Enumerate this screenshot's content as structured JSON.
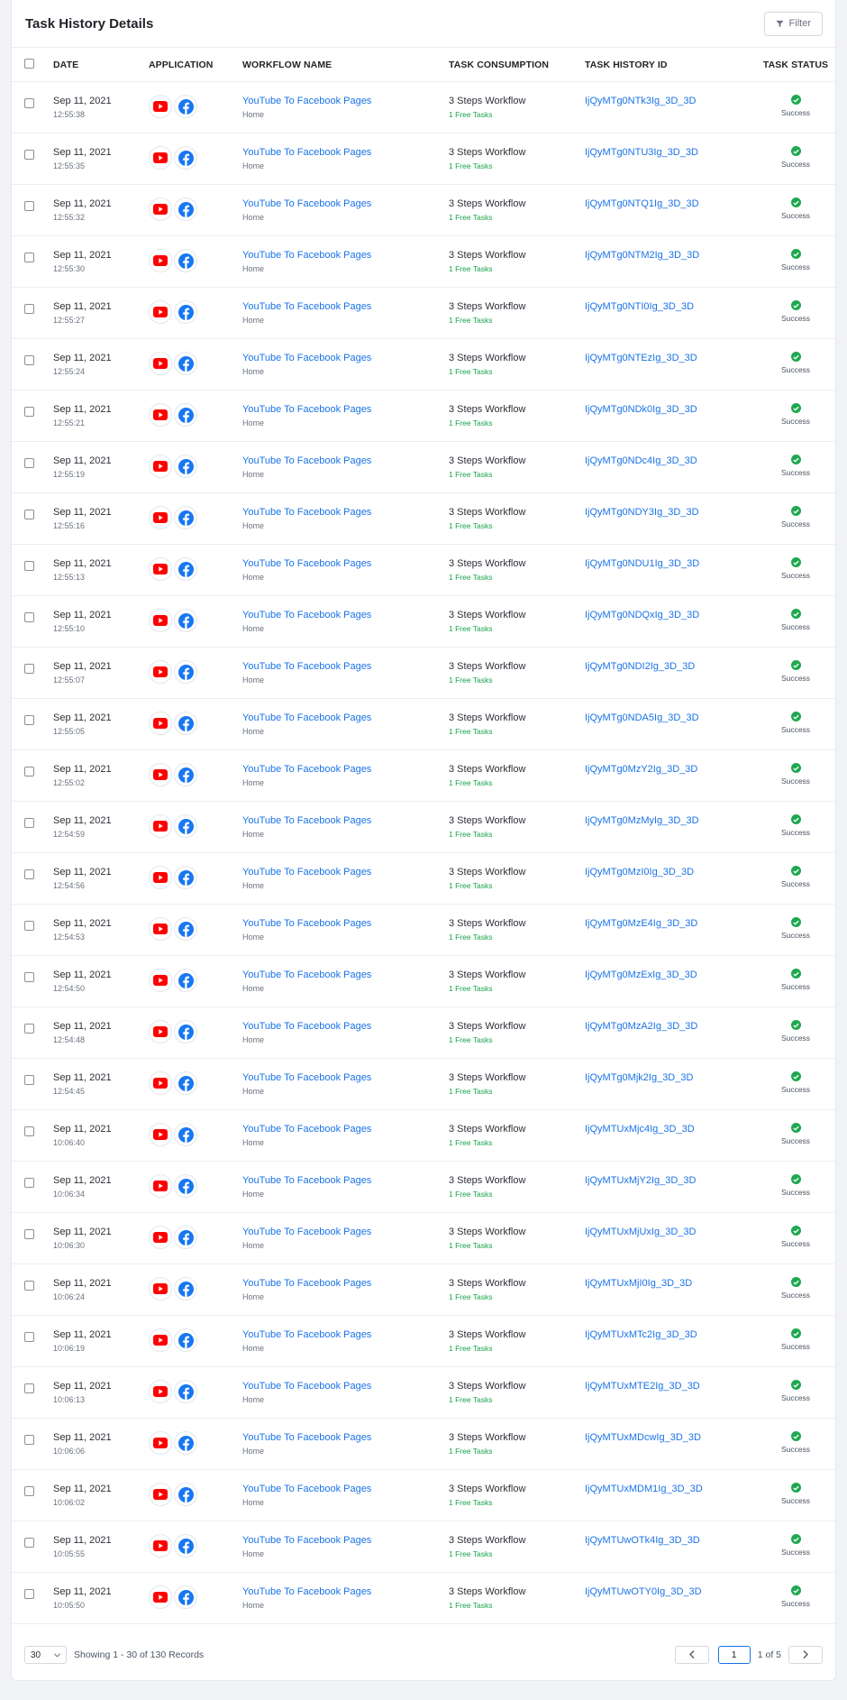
{
  "header": {
    "title": "Task History Details",
    "filter_label": "Filter"
  },
  "columns": {
    "date": "DATE",
    "application": "APPLICATION",
    "workflow_name": "WORKFLOW NAME",
    "task_consumption": "TASK CONSUMPTION",
    "task_history_id": "TASK HISTORY ID",
    "task_status": "TASK STATUS"
  },
  "icons": {
    "youtube": "youtube-icon",
    "facebook": "facebook-icon",
    "success": "check-circle-icon",
    "filter": "filter-icon"
  },
  "colors": {
    "link": "#1a73e8",
    "success": "#1fa84f",
    "free_tasks": "#17a34a",
    "youtube": "#ff0000",
    "facebook": "#1877f2"
  },
  "rows": [
    {
      "date": "Sep 11, 2021",
      "time": "12:55:38",
      "workflow": "YouTube To Facebook Pages",
      "workflow_sub": "Home",
      "consumption": "3 Steps Workflow",
      "free": "1 Free Tasks",
      "id": "IjQyMTg0NTk3Ig_3D_3D",
      "status": "Success"
    },
    {
      "date": "Sep 11, 2021",
      "time": "12:55:35",
      "workflow": "YouTube To Facebook Pages",
      "workflow_sub": "Home",
      "consumption": "3 Steps Workflow",
      "free": "1 Free Tasks",
      "id": "IjQyMTg0NTU3Ig_3D_3D",
      "status": "Success"
    },
    {
      "date": "Sep 11, 2021",
      "time": "12:55:32",
      "workflow": "YouTube To Facebook Pages",
      "workflow_sub": "Home",
      "consumption": "3 Steps Workflow",
      "free": "1 Free Tasks",
      "id": "IjQyMTg0NTQ1Ig_3D_3D",
      "status": "Success"
    },
    {
      "date": "Sep 11, 2021",
      "time": "12:55:30",
      "workflow": "YouTube To Facebook Pages",
      "workflow_sub": "Home",
      "consumption": "3 Steps Workflow",
      "free": "1 Free Tasks",
      "id": "IjQyMTg0NTM2Ig_3D_3D",
      "status": "Success"
    },
    {
      "date": "Sep 11, 2021",
      "time": "12:55:27",
      "workflow": "YouTube To Facebook Pages",
      "workflow_sub": "Home",
      "consumption": "3 Steps Workflow",
      "free": "1 Free Tasks",
      "id": "IjQyMTg0NTI0Ig_3D_3D",
      "status": "Success"
    },
    {
      "date": "Sep 11, 2021",
      "time": "12:55:24",
      "workflow": "YouTube To Facebook Pages",
      "workflow_sub": "Home",
      "consumption": "3 Steps Workflow",
      "free": "1 Free Tasks",
      "id": "IjQyMTg0NTEzIg_3D_3D",
      "status": "Success"
    },
    {
      "date": "Sep 11, 2021",
      "time": "12:55:21",
      "workflow": "YouTube To Facebook Pages",
      "workflow_sub": "Home",
      "consumption": "3 Steps Workflow",
      "free": "1 Free Tasks",
      "id": "IjQyMTg0NDk0Ig_3D_3D",
      "status": "Success"
    },
    {
      "date": "Sep 11, 2021",
      "time": "12:55:19",
      "workflow": "YouTube To Facebook Pages",
      "workflow_sub": "Home",
      "consumption": "3 Steps Workflow",
      "free": "1 Free Tasks",
      "id": "IjQyMTg0NDc4Ig_3D_3D",
      "status": "Success"
    },
    {
      "date": "Sep 11, 2021",
      "time": "12:55:16",
      "workflow": "YouTube To Facebook Pages",
      "workflow_sub": "Home",
      "consumption": "3 Steps Workflow",
      "free": "1 Free Tasks",
      "id": "IjQyMTg0NDY3Ig_3D_3D",
      "status": "Success"
    },
    {
      "date": "Sep 11, 2021",
      "time": "12:55:13",
      "workflow": "YouTube To Facebook Pages",
      "workflow_sub": "Home",
      "consumption": "3 Steps Workflow",
      "free": "1 Free Tasks",
      "id": "IjQyMTg0NDU1Ig_3D_3D",
      "status": "Success"
    },
    {
      "date": "Sep 11, 2021",
      "time": "12:55:10",
      "workflow": "YouTube To Facebook Pages",
      "workflow_sub": "Home",
      "consumption": "3 Steps Workflow",
      "free": "1 Free Tasks",
      "id": "IjQyMTg0NDQxIg_3D_3D",
      "status": "Success"
    },
    {
      "date": "Sep 11, 2021",
      "time": "12:55:07",
      "workflow": "YouTube To Facebook Pages",
      "workflow_sub": "Home",
      "consumption": "3 Steps Workflow",
      "free": "1 Free Tasks",
      "id": "IjQyMTg0NDI2Ig_3D_3D",
      "status": "Success"
    },
    {
      "date": "Sep 11, 2021",
      "time": "12:55:05",
      "workflow": "YouTube To Facebook Pages",
      "workflow_sub": "Home",
      "consumption": "3 Steps Workflow",
      "free": "1 Free Tasks",
      "id": "IjQyMTg0NDA5Ig_3D_3D",
      "status": "Success"
    },
    {
      "date": "Sep 11, 2021",
      "time": "12:55:02",
      "workflow": "YouTube To Facebook Pages",
      "workflow_sub": "Home",
      "consumption": "3 Steps Workflow",
      "free": "1 Free Tasks",
      "id": "IjQyMTg0MzY2Ig_3D_3D",
      "status": "Success"
    },
    {
      "date": "Sep 11, 2021",
      "time": "12:54:59",
      "workflow": "YouTube To Facebook Pages",
      "workflow_sub": "Home",
      "consumption": "3 Steps Workflow",
      "free": "1 Free Tasks",
      "id": "IjQyMTg0MzMyIg_3D_3D",
      "status": "Success"
    },
    {
      "date": "Sep 11, 2021",
      "time": "12:54:56",
      "workflow": "YouTube To Facebook Pages",
      "workflow_sub": "Home",
      "consumption": "3 Steps Workflow",
      "free": "1 Free Tasks",
      "id": "IjQyMTg0MzI0Ig_3D_3D",
      "status": "Success"
    },
    {
      "date": "Sep 11, 2021",
      "time": "12:54:53",
      "workflow": "YouTube To Facebook Pages",
      "workflow_sub": "Home",
      "consumption": "3 Steps Workflow",
      "free": "1 Free Tasks",
      "id": "IjQyMTg0MzE4Ig_3D_3D",
      "status": "Success"
    },
    {
      "date": "Sep 11, 2021",
      "time": "12:54:50",
      "workflow": "YouTube To Facebook Pages",
      "workflow_sub": "Home",
      "consumption": "3 Steps Workflow",
      "free": "1 Free Tasks",
      "id": "IjQyMTg0MzExIg_3D_3D",
      "status": "Success"
    },
    {
      "date": "Sep 11, 2021",
      "time": "12:54:48",
      "workflow": "YouTube To Facebook Pages",
      "workflow_sub": "Home",
      "consumption": "3 Steps Workflow",
      "free": "1 Free Tasks",
      "id": "IjQyMTg0MzA2Ig_3D_3D",
      "status": "Success"
    },
    {
      "date": "Sep 11, 2021",
      "time": "12:54:45",
      "workflow": "YouTube To Facebook Pages",
      "workflow_sub": "Home",
      "consumption": "3 Steps Workflow",
      "free": "1 Free Tasks",
      "id": "IjQyMTg0Mjk2Ig_3D_3D",
      "status": "Success"
    },
    {
      "date": "Sep 11, 2021",
      "time": "10:06:40",
      "workflow": "YouTube To Facebook Pages",
      "workflow_sub": "Home",
      "consumption": "3 Steps Workflow",
      "free": "1 Free Tasks",
      "id": "IjQyMTUxMjc4Ig_3D_3D",
      "status": "Success"
    },
    {
      "date": "Sep 11, 2021",
      "time": "10:06:34",
      "workflow": "YouTube To Facebook Pages",
      "workflow_sub": "Home",
      "consumption": "3 Steps Workflow",
      "free": "1 Free Tasks",
      "id": "IjQyMTUxMjY2Ig_3D_3D",
      "status": "Success"
    },
    {
      "date": "Sep 11, 2021",
      "time": "10:06:30",
      "workflow": "YouTube To Facebook Pages",
      "workflow_sub": "Home",
      "consumption": "3 Steps Workflow",
      "free": "1 Free Tasks",
      "id": "IjQyMTUxMjUxIg_3D_3D",
      "status": "Success"
    },
    {
      "date": "Sep 11, 2021",
      "time": "10:06:24",
      "workflow": "YouTube To Facebook Pages",
      "workflow_sub": "Home",
      "consumption": "3 Steps Workflow",
      "free": "1 Free Tasks",
      "id": "IjQyMTUxMjI0Ig_3D_3D",
      "status": "Success"
    },
    {
      "date": "Sep 11, 2021",
      "time": "10:06:19",
      "workflow": "YouTube To Facebook Pages",
      "workflow_sub": "Home",
      "consumption": "3 Steps Workflow",
      "free": "1 Free Tasks",
      "id": "IjQyMTUxMTc2Ig_3D_3D",
      "status": "Success"
    },
    {
      "date": "Sep 11, 2021",
      "time": "10:06:13",
      "workflow": "YouTube To Facebook Pages",
      "workflow_sub": "Home",
      "consumption": "3 Steps Workflow",
      "free": "1 Free Tasks",
      "id": "IjQyMTUxMTE2Ig_3D_3D",
      "status": "Success"
    },
    {
      "date": "Sep 11, 2021",
      "time": "10:06:06",
      "workflow": "YouTube To Facebook Pages",
      "workflow_sub": "Home",
      "consumption": "3 Steps Workflow",
      "free": "1 Free Tasks",
      "id": "IjQyMTUxMDcwIg_3D_3D",
      "status": "Success"
    },
    {
      "date": "Sep 11, 2021",
      "time": "10:06:02",
      "workflow": "YouTube To Facebook Pages",
      "workflow_sub": "Home",
      "consumption": "3 Steps Workflow",
      "free": "1 Free Tasks",
      "id": "IjQyMTUxMDM1Ig_3D_3D",
      "status": "Success"
    },
    {
      "date": "Sep 11, 2021",
      "time": "10:05:55",
      "workflow": "YouTube To Facebook Pages",
      "workflow_sub": "Home",
      "consumption": "3 Steps Workflow",
      "free": "1 Free Tasks",
      "id": "IjQyMTUwOTk4Ig_3D_3D",
      "status": "Success"
    },
    {
      "date": "Sep 11, 2021",
      "time": "10:05:50",
      "workflow": "YouTube To Facebook Pages",
      "workflow_sub": "Home",
      "consumption": "3 Steps Workflow",
      "free": "1 Free Tasks",
      "id": "IjQyMTUwOTY0Ig_3D_3D",
      "status": "Success"
    }
  ],
  "footer": {
    "page_size": "30",
    "showing": "Showing 1 - 30 of 130 Records",
    "current_page": "1",
    "page_of": "1 of 5"
  }
}
